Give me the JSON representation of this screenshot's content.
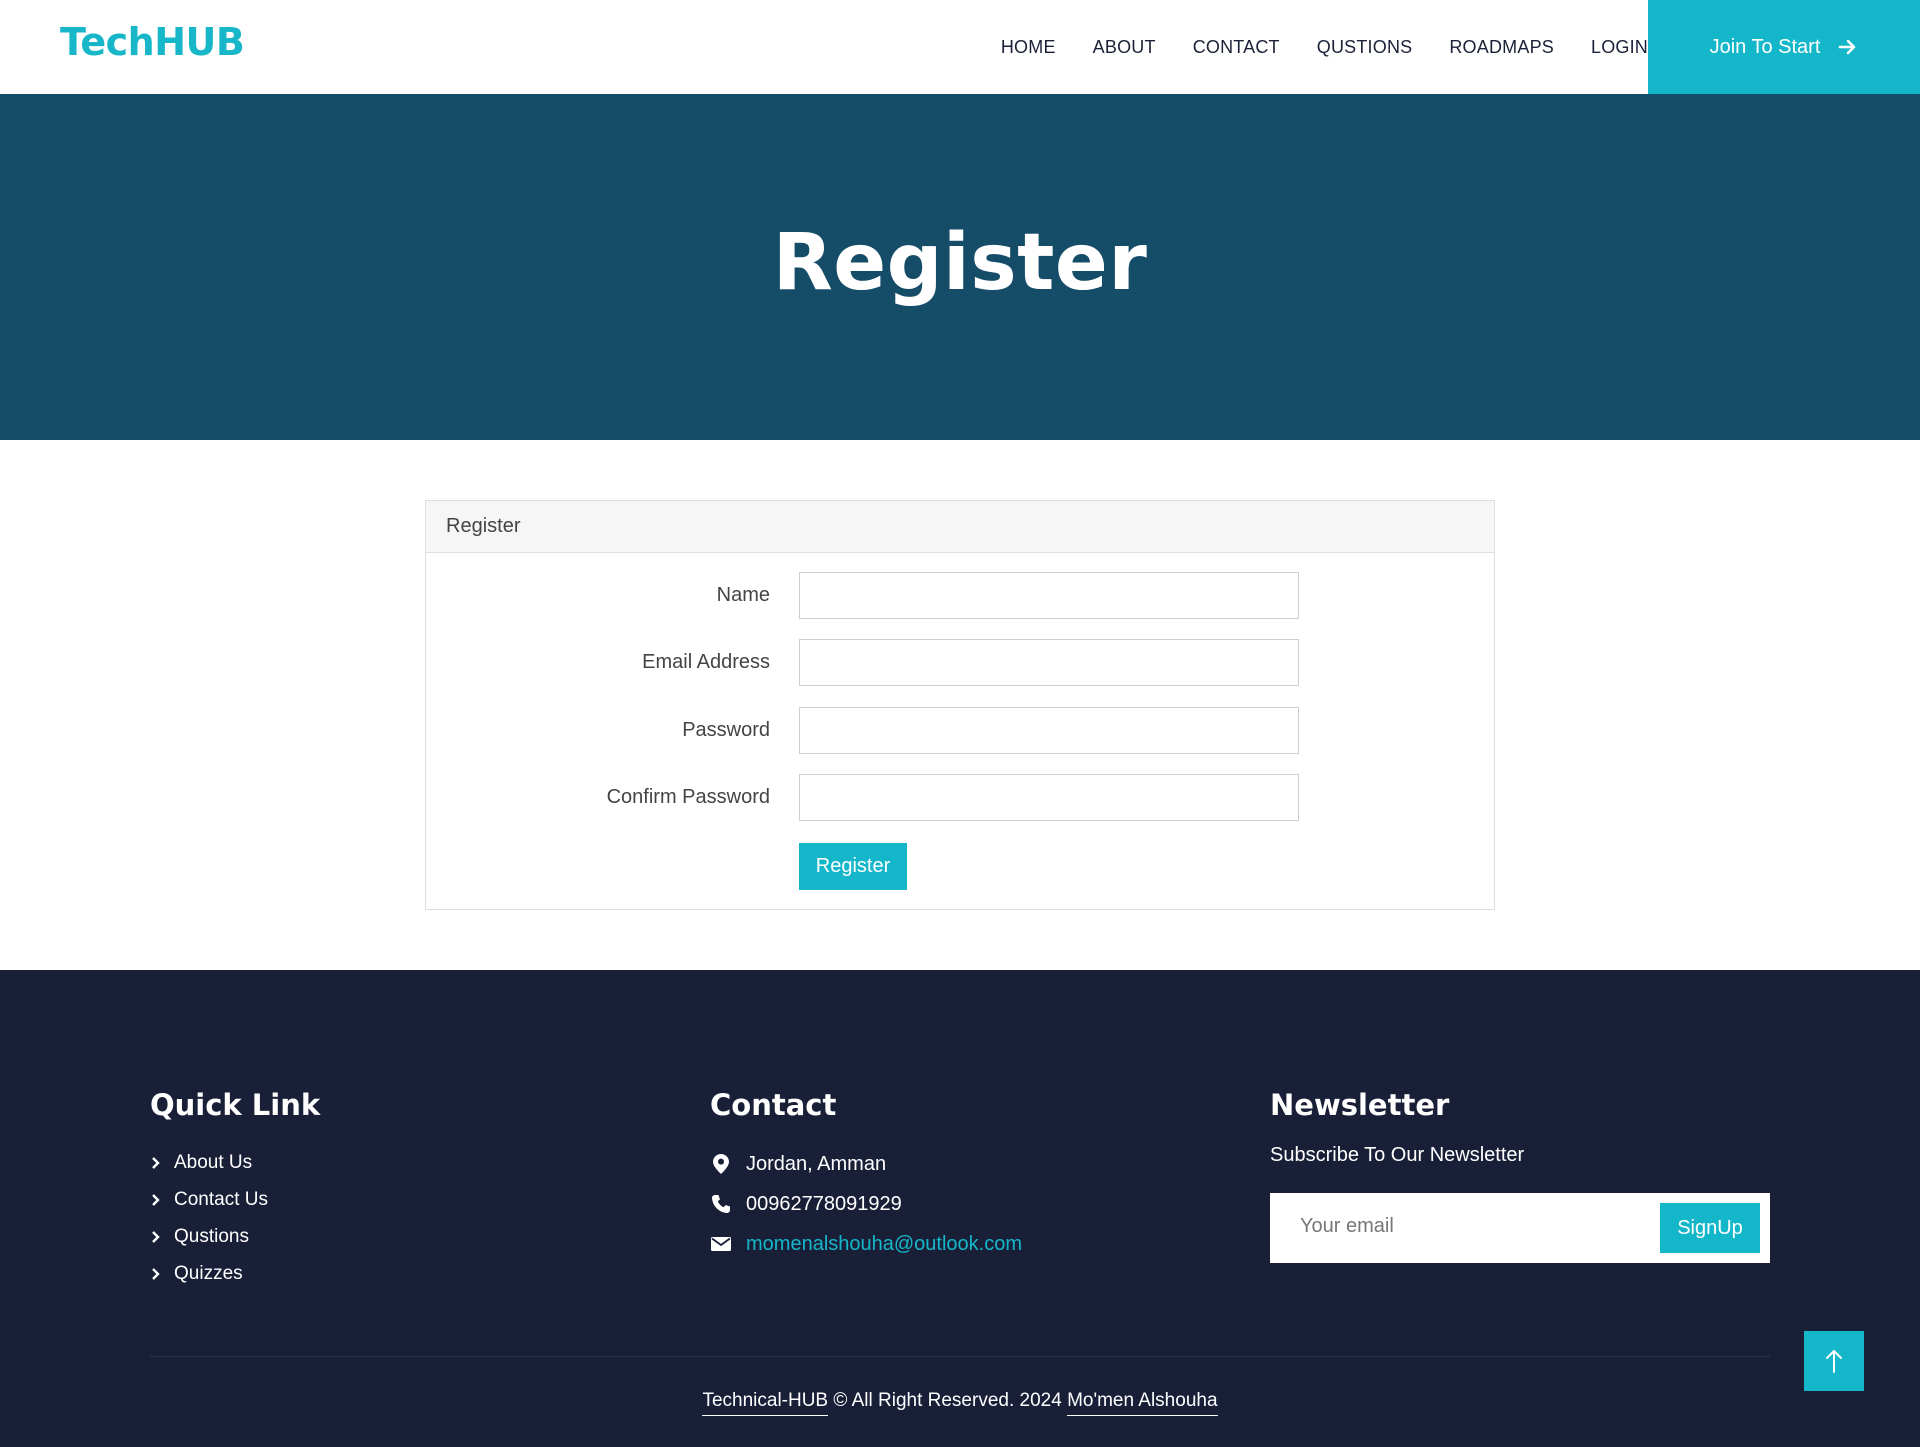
{
  "brand": "TechHUB",
  "nav": {
    "items": [
      "HOME",
      "ABOUT",
      "CONTACT",
      "QUSTIONS",
      "ROADMAPS",
      "LOGIN"
    ],
    "cta_label": "Join To Start"
  },
  "hero": {
    "title": "Register"
  },
  "form": {
    "header": "Register",
    "fields": [
      {
        "label": "Name",
        "value": ""
      },
      {
        "label": "Email Address",
        "value": ""
      },
      {
        "label": "Password",
        "value": ""
      },
      {
        "label": "Confirm Password",
        "value": ""
      }
    ],
    "submit_label": "Register"
  },
  "footer": {
    "quick_link": {
      "title": "Quick Link",
      "items": [
        "About Us",
        "Contact Us",
        "Qustions",
        "Quizzes"
      ]
    },
    "contact": {
      "title": "Contact",
      "address": "Jordan, Amman",
      "phone": "00962778091929",
      "email": "momenalshouha@outlook.com"
    },
    "newsletter": {
      "title": "Newsletter",
      "subtitle": "Subscribe To Our Newsletter",
      "placeholder": "Your email",
      "button_label": "SignUp"
    },
    "copyright": {
      "site": "Technical-HUB",
      "text": " © All Right Reserved. 2024 ",
      "author": "Mo'men Alshouha"
    }
  },
  "colors": {
    "accent": "#14b7c9",
    "hero_bg": "#154d68",
    "footer_bg": "#1a1f38"
  },
  "icons": [
    "arrow-right-icon",
    "map-marker-icon",
    "phone-icon",
    "envelope-icon",
    "chevron-right-icon",
    "arrow-up-icon"
  ]
}
